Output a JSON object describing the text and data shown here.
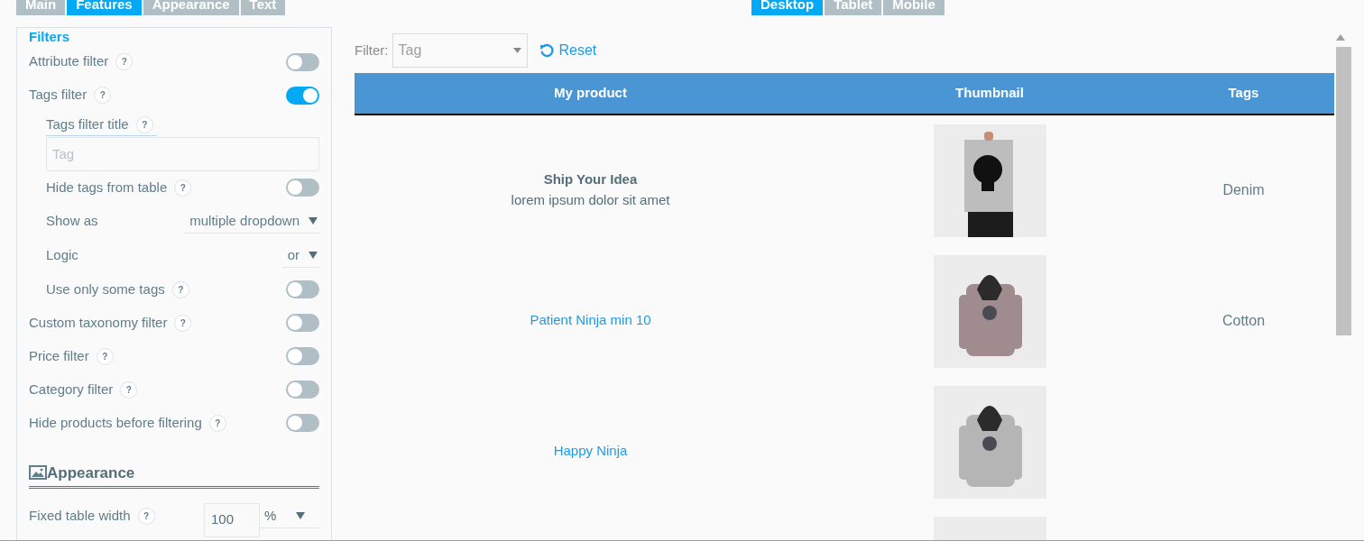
{
  "settings_tabs": [
    {
      "label": "Main",
      "selected": false
    },
    {
      "label": "Features",
      "selected": true
    },
    {
      "label": "Appearance",
      "selected": false
    },
    {
      "label": "Text",
      "selected": false
    }
  ],
  "device_tabs": [
    {
      "label": "Desktop",
      "selected": true
    },
    {
      "label": "Tablet",
      "selected": false
    },
    {
      "label": "Mobile",
      "selected": false
    }
  ],
  "panel": {
    "heading": "Filters",
    "items": [
      {
        "kind": "toggle",
        "label": "Attribute filter",
        "help": "?",
        "on": false
      },
      {
        "kind": "toggle",
        "label": "Tags filter",
        "help": "?",
        "on": true,
        "children": [
          {
            "kind": "text",
            "label": "Tags filter title",
            "help": "?",
            "placeholder": "Tag"
          },
          {
            "kind": "toggle",
            "label": "Hide tags from table",
            "help": "?",
            "on": false
          },
          {
            "kind": "select",
            "label": "Show as",
            "value": "multiple dropdown"
          },
          {
            "kind": "select",
            "label": "Logic",
            "value": "or"
          },
          {
            "kind": "toggle",
            "label": "Use only some tags",
            "help": "?",
            "on": false
          }
        ]
      },
      {
        "kind": "toggle",
        "label": "Custom taxonomy filter",
        "help": "?",
        "on": false
      },
      {
        "kind": "toggle",
        "label": "Price filter",
        "help": "?",
        "on": false
      },
      {
        "kind": "toggle",
        "label": "Category filter",
        "help": "?",
        "on": false
      },
      {
        "kind": "toggle",
        "label": "Hide products before filtering",
        "help": "?",
        "on": false
      }
    ],
    "appearance_heading": "Appearance",
    "appearance_items": [
      {
        "kind": "width",
        "label": "Fixed table width",
        "help": "?",
        "value": "100",
        "unit": "%"
      }
    ]
  },
  "preview": {
    "filter_label": "Filter:",
    "filter_placeholder": "Tag",
    "reset": "Reset",
    "table": {
      "columns": [
        "My product",
        "Thumbnail",
        "Tags"
      ],
      "rows": [
        {
          "title": "Ship Your Idea",
          "link": false,
          "description": "lorem ipsum dolor sit amet",
          "tags": "Denim",
          "thumbnail": {
            "kind": "picture"
          }
        },
        {
          "title": "Patient Ninja min 10",
          "link": true,
          "tags": "Cotton",
          "thumbnail": {
            "kind": "picture"
          }
        },
        {
          "title": "Happy Ninja",
          "link": true,
          "thumbnail": {
            "kind": "picture"
          }
        },
        {
          "thumbnail": {
            "kind": "picture"
          }
        }
      ]
    }
  }
}
